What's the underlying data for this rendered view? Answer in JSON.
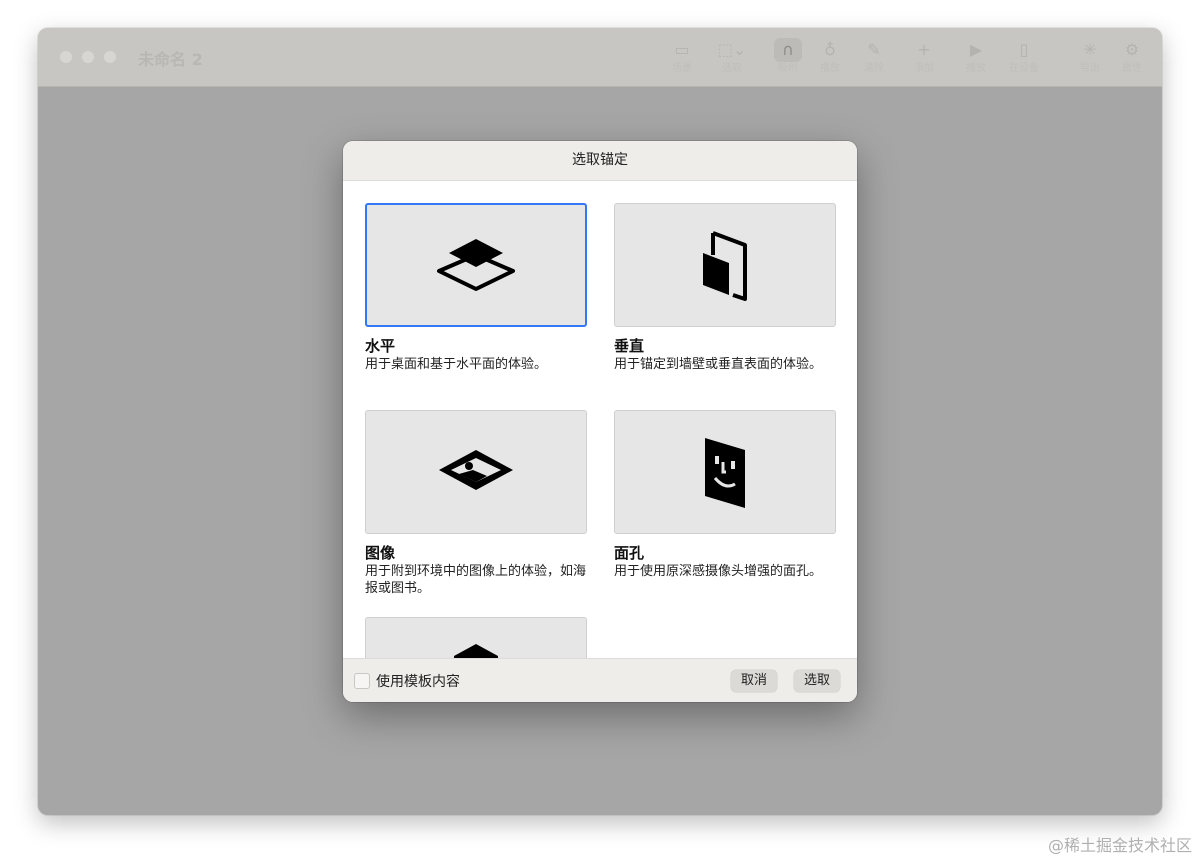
{
  "window": {
    "title": "未命名 2"
  },
  "toolbar": {
    "items": [
      {
        "icon": "sidebar-icon",
        "label": "场景"
      },
      {
        "icon": "scene-icon",
        "label": "选取"
      },
      {
        "icon": "magnet-icon",
        "label": "吸附"
      },
      {
        "icon": "drop-icon",
        "label": "播放"
      },
      {
        "icon": "brush-icon",
        "label": "清除"
      },
      {
        "icon": "plus-icon",
        "label": "添加"
      },
      {
        "icon": "play-icon",
        "label": "播放"
      },
      {
        "icon": "phone-icon",
        "label": "在设备"
      },
      {
        "icon": "spinner-icon",
        "label": "导出"
      },
      {
        "icon": "gear-icon",
        "label": "属性"
      }
    ]
  },
  "dialog": {
    "title": "选取锚定",
    "options": [
      {
        "title": "水平",
        "desc": "用于桌面和基于水平面的体验。",
        "icon": "horizontal-plane-icon",
        "selected": true
      },
      {
        "title": "垂直",
        "desc": "用于锚定到墙壁或垂直表面的体验。",
        "icon": "vertical-plane-icon",
        "selected": false
      },
      {
        "title": "图像",
        "desc": "用于附到环境中的图像上的体验，如海报或图书。",
        "icon": "image-anchor-icon",
        "selected": false
      },
      {
        "title": "面孔",
        "desc": "用于使用原深感摄像头增强的面孔。",
        "icon": "face-anchor-icon",
        "selected": false
      }
    ],
    "template_checkbox_label": "使用模板内容",
    "cancel_label": "取消",
    "choose_label": "选取"
  },
  "watermark": "@稀土掘金技术社区",
  "colors": {
    "accent": "#3478f6",
    "overlay": "#a6a6a6"
  }
}
